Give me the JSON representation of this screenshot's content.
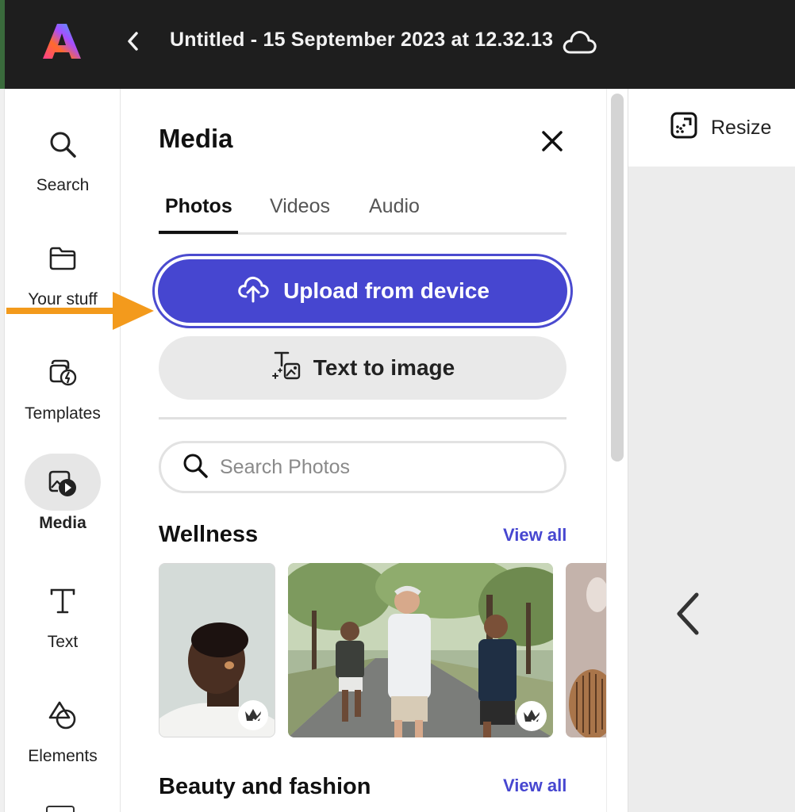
{
  "header": {
    "title": "Untitled - 15 September 2023 at 12.32.13",
    "logo_icon": "adobe-express-logo",
    "back_icon": "chevron-left-icon",
    "cloud_icon": "cloud-icon"
  },
  "rail": {
    "items": [
      {
        "label": "Search",
        "icon": "search-icon"
      },
      {
        "label": "Your stuff",
        "icon": "folder-icon"
      },
      {
        "label": "Templates",
        "icon": "templates-icon"
      },
      {
        "label": "Media",
        "icon": "media-icon",
        "active": true
      },
      {
        "label": "Text",
        "icon": "text-icon"
      },
      {
        "label": "Elements",
        "icon": "elements-icon"
      }
    ]
  },
  "panel": {
    "title": "Media",
    "tabs": [
      {
        "label": "Photos",
        "active": true
      },
      {
        "label": "Videos"
      },
      {
        "label": "Audio"
      }
    ],
    "upload_label": "Upload from device",
    "text_to_image_label": "Text to image",
    "search_placeholder": "Search Photos",
    "sections": [
      {
        "title": "Wellness",
        "view_all": "View all"
      },
      {
        "title": "Beauty and fashion",
        "view_all": "View all"
      }
    ]
  },
  "canvas": {
    "resize_label": "Resize"
  },
  "colors": {
    "accent": "#4646d0",
    "topbar": "#1e1e1e",
    "annotation_arrow": "#f39a1c"
  }
}
